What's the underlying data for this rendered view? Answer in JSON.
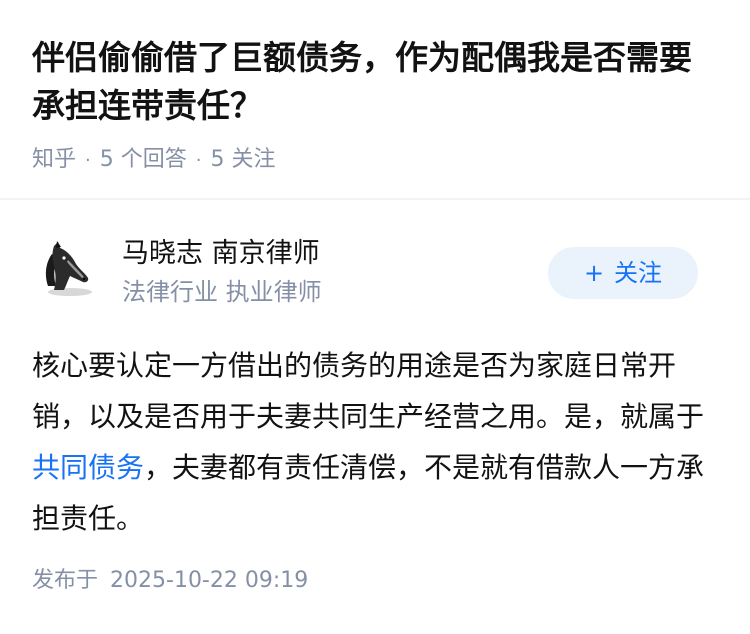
{
  "question": {
    "title": "伴侣偷偷借了巨额债务，作为配偶我是否需要承担连带责任？"
  },
  "meta": {
    "source": "知乎",
    "answers": "5 个回答",
    "followers": "5 关注",
    "separator": "·"
  },
  "author": {
    "name": "马晓志 南京律师",
    "headline": "法律行业 执业律师",
    "avatar_icon": "horse-avatar-icon"
  },
  "follow_button": {
    "plus": "+",
    "label": "关注"
  },
  "answer": {
    "text_before_link": "核心要认定一方借出的债务的用途是否为家庭日常开销，以及是否用于夫妻共同生产经营之用。是，就属于",
    "link_text": "共同债务",
    "text_after_link": "，夫妻都有责任清偿，不是就有借款人一方承担责任。"
  },
  "published": {
    "label": "发布于",
    "date": "2025-10-22 09:19"
  },
  "colors": {
    "title": "#121212",
    "meta": "#8590a6",
    "link": "#1772f6",
    "follow_bg": "#eaf2fc"
  }
}
